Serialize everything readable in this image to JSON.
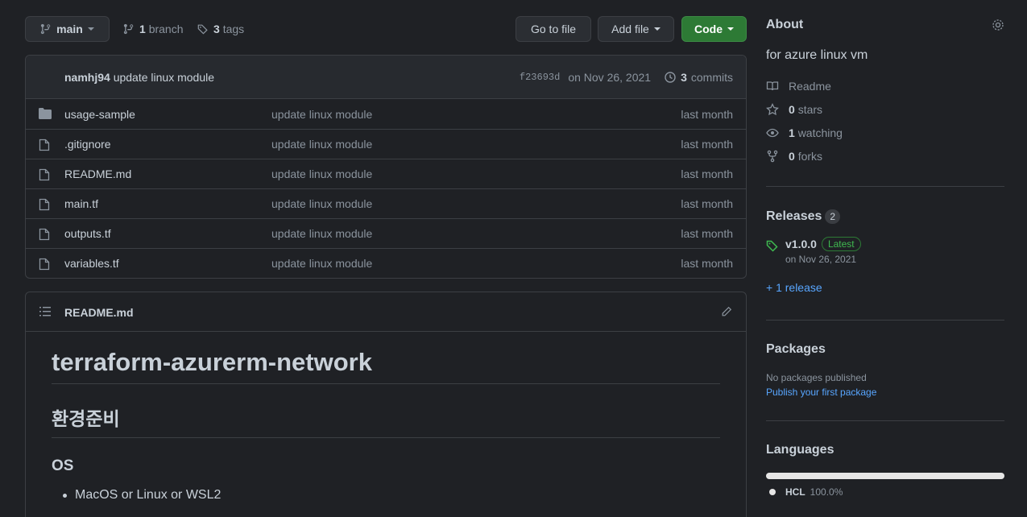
{
  "toolbar": {
    "branch": "main",
    "branches_count": "1",
    "branches_label": "branch",
    "tags_count": "3",
    "tags_label": "tags",
    "goto_file": "Go to file",
    "add_file": "Add file",
    "code": "Code"
  },
  "commit": {
    "author": "namhj94",
    "message": "update linux module",
    "sha": "f23693d",
    "date": "on Nov 26, 2021",
    "commits_count": "3",
    "commits_label": "commits"
  },
  "files": [
    {
      "type": "folder",
      "name": "usage-sample",
      "message": "update linux module",
      "age": "last month"
    },
    {
      "type": "file",
      "name": ".gitignore",
      "message": "update linux module",
      "age": "last month"
    },
    {
      "type": "file",
      "name": "README.md",
      "message": "update linux module",
      "age": "last month"
    },
    {
      "type": "file",
      "name": "main.tf",
      "message": "update linux module",
      "age": "last month"
    },
    {
      "type": "file",
      "name": "outputs.tf",
      "message": "update linux module",
      "age": "last month"
    },
    {
      "type": "file",
      "name": "variables.tf",
      "message": "update linux module",
      "age": "last month"
    }
  ],
  "readme": {
    "filename": "README.md",
    "h1": "terraform-azurerm-network",
    "h2": "환경준비",
    "h3": "OS",
    "item1": "MacOS or Linux or WSL2"
  },
  "about": {
    "title": "About",
    "description": "for azure linux vm",
    "readme": "Readme",
    "stars_count": "0",
    "stars_label": "stars",
    "watching_count": "1",
    "watching_label": "watching",
    "forks_count": "0",
    "forks_label": "forks"
  },
  "releases": {
    "title": "Releases",
    "count": "2",
    "version": "v1.0.0",
    "latest": "Latest",
    "date": "on Nov 26, 2021",
    "more": "+ 1 release"
  },
  "packages": {
    "title": "Packages",
    "none": "No packages published",
    "publish": "Publish your first package"
  },
  "languages": {
    "title": "Languages",
    "name": "HCL",
    "percent": "100.0%",
    "share": 1.0
  },
  "colors": {
    "accent_green": "#2d7a35",
    "link_blue": "#58a6ff",
    "background": "#1f2125"
  }
}
